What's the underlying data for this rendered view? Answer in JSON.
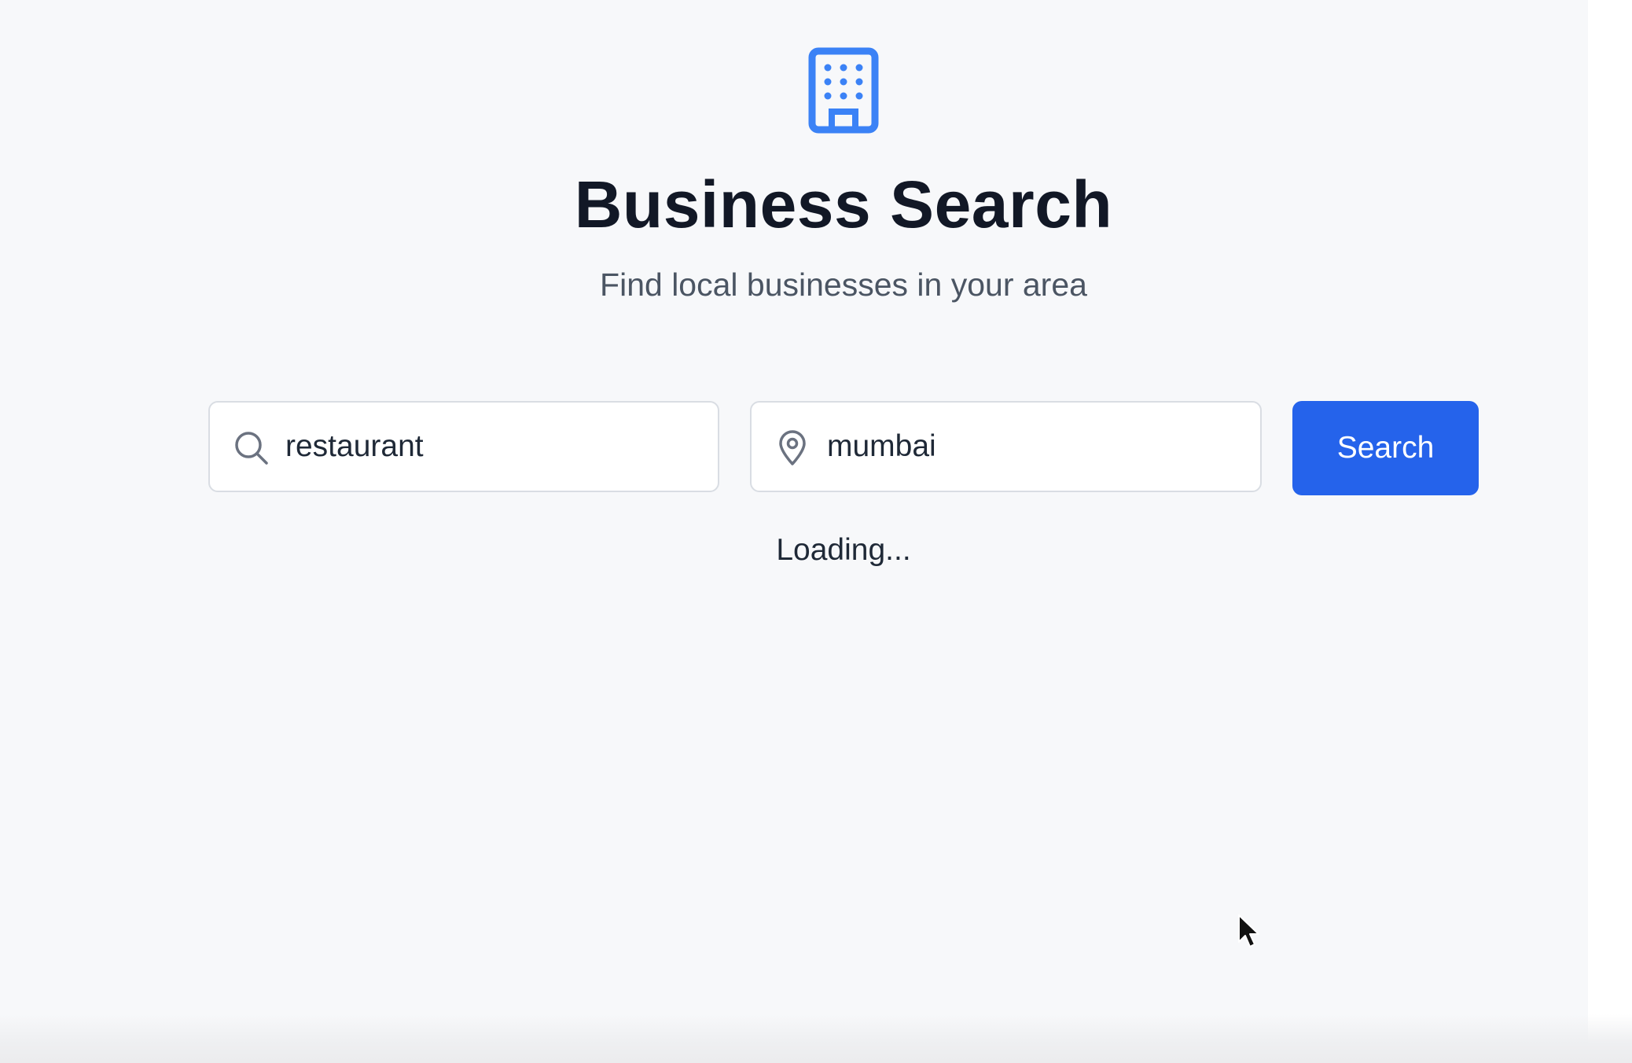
{
  "page": {
    "title": "Business Search",
    "subtitle": "Find local businesses in your area",
    "logo_icon": "building-icon",
    "accent_color": "#2563eb"
  },
  "search": {
    "query": {
      "icon": "search-icon",
      "value": "restaurant"
    },
    "location": {
      "icon": "map-pin-icon",
      "value": "mumbai"
    },
    "button_label": "Search"
  },
  "status": {
    "text": "Loading..."
  }
}
